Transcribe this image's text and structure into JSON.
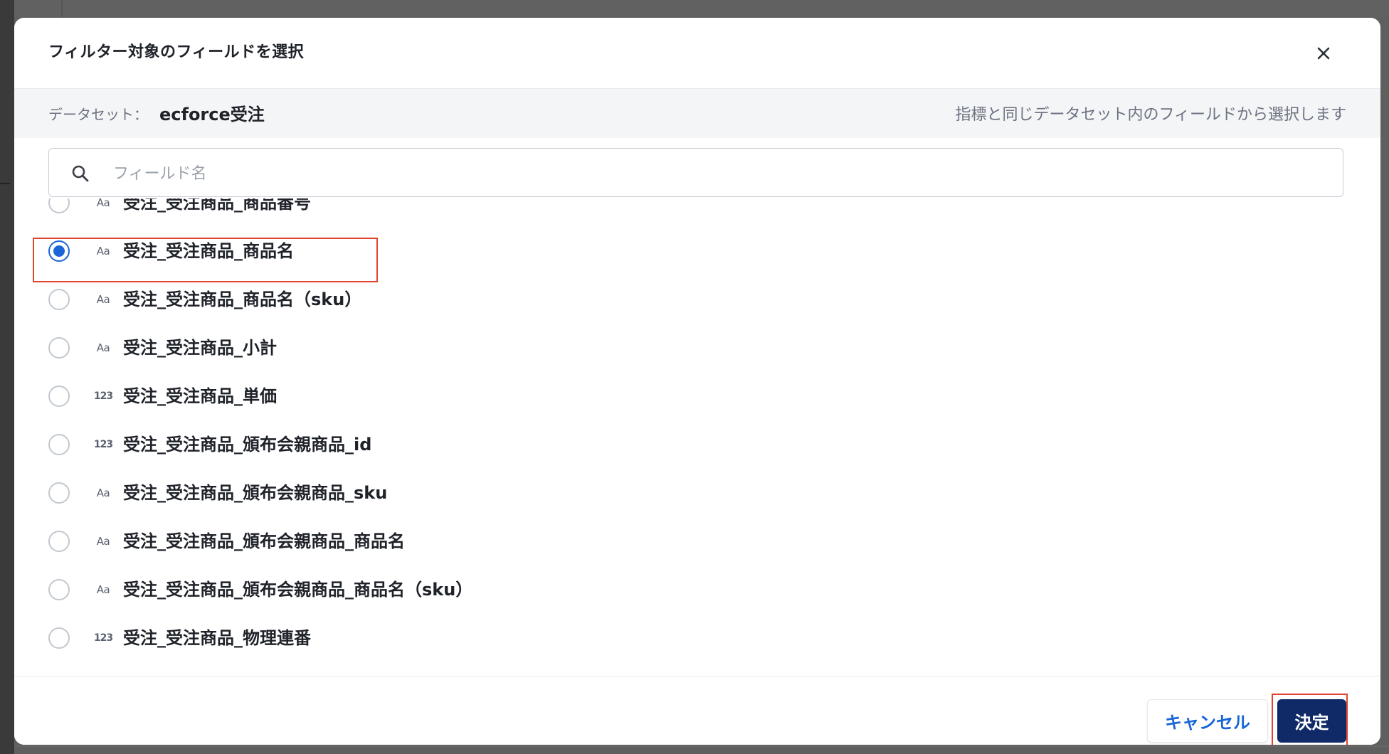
{
  "modal": {
    "title": "フィルター対象のフィールドを選択",
    "close_icon": "close-icon"
  },
  "dataset": {
    "label": "データセット：",
    "name": "ecforce受注",
    "hint": "指標と同じデータセット内のフィールドから選択します"
  },
  "search": {
    "placeholder": "フィールド名",
    "value": "",
    "icon": "search-icon"
  },
  "fields": [
    {
      "type_icon": "Aa",
      "type": "text",
      "label": "受注_受注商品_商品番号",
      "selected": false
    },
    {
      "type_icon": "Aa",
      "type": "text",
      "label": "受注_受注商品_商品名",
      "selected": true
    },
    {
      "type_icon": "Aa",
      "type": "text",
      "label": "受注_受注商品_商品名（sku）",
      "selected": false
    },
    {
      "type_icon": "Aa",
      "type": "text",
      "label": "受注_受注商品_小計",
      "selected": false
    },
    {
      "type_icon": "123",
      "type": "number",
      "label": "受注_受注商品_単価",
      "selected": false
    },
    {
      "type_icon": "123",
      "type": "number",
      "label": "受注_受注商品_頒布会親商品_id",
      "selected": false
    },
    {
      "type_icon": "Aa",
      "type": "text",
      "label": "受注_受注商品_頒布会親商品_sku",
      "selected": false
    },
    {
      "type_icon": "Aa",
      "type": "text",
      "label": "受注_受注商品_頒布会親商品_商品名",
      "selected": false
    },
    {
      "type_icon": "Aa",
      "type": "text",
      "label": "受注_受注商品_頒布会親商品_商品名（sku）",
      "selected": false
    },
    {
      "type_icon": "123",
      "type": "number",
      "label": "受注_受注商品_物理連番",
      "selected": false
    }
  ],
  "footer": {
    "cancel_label": "キャンセル",
    "confirm_label": "決定"
  },
  "colors": {
    "accent": "#1a66d9",
    "primary_button": "#0f2a66",
    "highlight": "#e2452e"
  }
}
